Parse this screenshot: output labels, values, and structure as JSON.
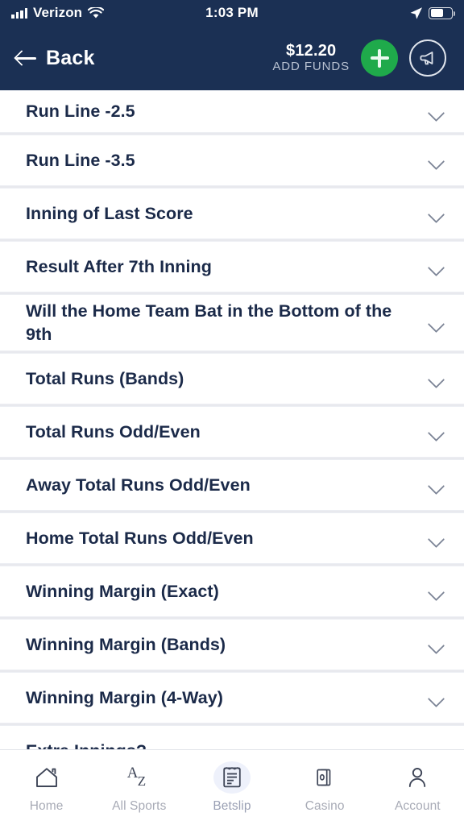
{
  "status_bar": {
    "carrier": "Verizon",
    "time": "1:03 PM",
    "wifi_icon": "wifi-icon",
    "signal_icon": "signal-bars-icon",
    "location_icon": "location-arrow-icon",
    "battery_icon": "battery-icon",
    "battery_level": 62
  },
  "header": {
    "back_label": "Back",
    "back_icon": "arrow-left-icon",
    "balance": "$12.20",
    "add_funds_label": "ADD FUNDS",
    "add_funds_icon": "plus-icon",
    "promotions_icon": "megaphone-icon",
    "accent_green": "#1faa4b",
    "navy": "#1b3054"
  },
  "markets": {
    "chevron_icon": "chevron-down-icon",
    "items": [
      {
        "label": "Run Line -2.5"
      },
      {
        "label": "Run Line -3.5"
      },
      {
        "label": "Inning of Last Score"
      },
      {
        "label": "Result After 7th Inning"
      },
      {
        "label": "Will the Home Team Bat in the Bottom of the 9th"
      },
      {
        "label": "Total Runs (Bands)"
      },
      {
        "label": "Total Runs Odd/Even"
      },
      {
        "label": "Away Total Runs Odd/Even"
      },
      {
        "label": "Home Total Runs Odd/Even"
      },
      {
        "label": "Winning Margin (Exact)"
      },
      {
        "label": "Winning Margin (Bands)"
      },
      {
        "label": "Winning Margin (4-Way)"
      },
      {
        "label": "Extra Innings?"
      }
    ]
  },
  "tabbar": {
    "tabs": [
      {
        "label": "Home",
        "icon": "home-icon",
        "active": false
      },
      {
        "label": "All Sports",
        "icon": "az-icon",
        "active": false
      },
      {
        "label": "Betslip",
        "icon": "betslip-icon",
        "active": true
      },
      {
        "label": "Casino",
        "icon": "cards-icon",
        "active": false
      },
      {
        "label": "Account",
        "icon": "person-icon",
        "active": false
      }
    ]
  }
}
